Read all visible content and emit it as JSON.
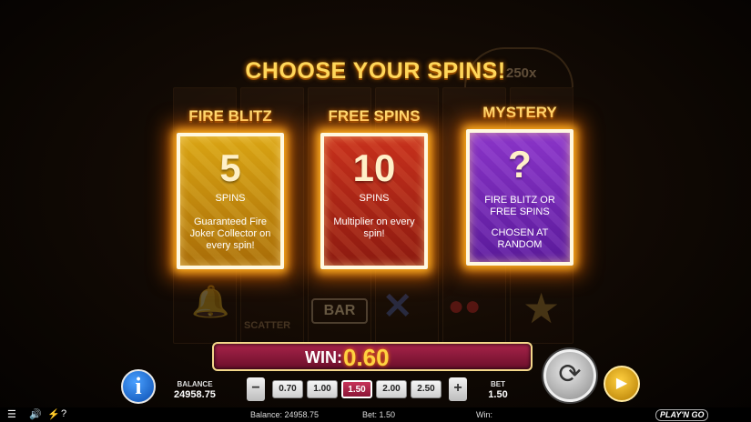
{
  "title": "CHOOSE YOUR SPINS!",
  "background": {
    "multiplier_text": "250x",
    "bar_text": "BAR",
    "scatter_text": "SCATTER"
  },
  "options": [
    {
      "label": "FIRE BLITZ",
      "number": "5",
      "spins": "SPINS",
      "description": "Guaranteed Fire Joker Collector on every spin!",
      "color": "#d9a413"
    },
    {
      "label": "FREE SPINS",
      "number": "10",
      "spins": "SPINS",
      "description": "Multiplier on every spin!",
      "color": "#c7301c"
    },
    {
      "label": "MYSTERY",
      "number": "?",
      "spins": "FIRE BLITZ OR FREE SPINS",
      "description": "CHOSEN AT RANDOM",
      "color": "#8a34c8"
    }
  ],
  "win": {
    "label": "WIN:",
    "value": "0.60"
  },
  "balance": {
    "label": "BALANCE",
    "value": "24958.75"
  },
  "bet": {
    "label": "BET",
    "value": "1.50",
    "options": [
      "0.70",
      "1.00",
      "1.50",
      "2.00",
      "2.50"
    ],
    "selected": "1.50"
  },
  "buttons": {
    "info": "i",
    "decrease": "−",
    "increase": "+",
    "spin_icon": "refresh-icon",
    "autoplay_icon": "play-icon"
  },
  "footer": {
    "balance": "Balance: 24958.75",
    "bet": "Bet: 1.50",
    "win": "Win:",
    "logo": "PLAY'N GO"
  }
}
